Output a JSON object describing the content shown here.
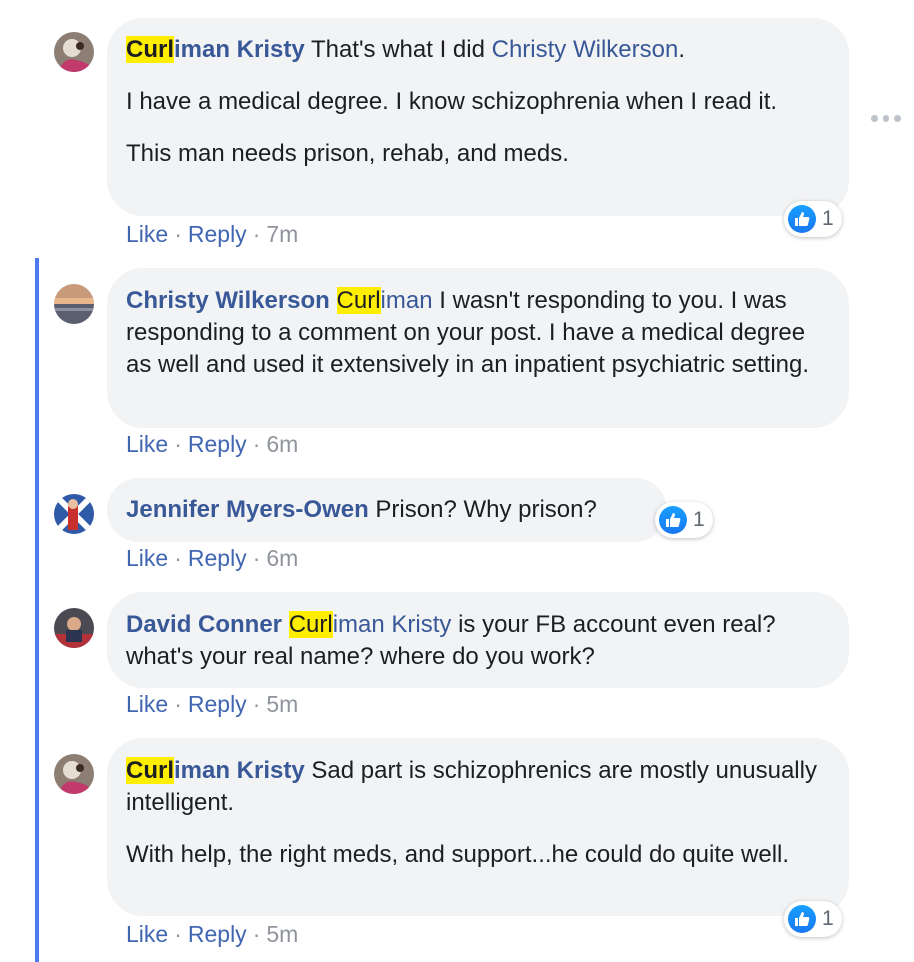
{
  "colors": {
    "link": "#385898",
    "action_link": "#4267b2",
    "highlight": "#ffee00",
    "thread_line": "#4b7bef",
    "bubble": "#f2f3f5",
    "like_blue": "#1877f2"
  },
  "icons": {
    "reaction": "like-thumbs-up-icon",
    "menu": "more-options-icon"
  },
  "comments": [
    {
      "author_highlight": "Curl",
      "author_rest": "iman Kristy",
      "text_before_mention": "That's what I did",
      "mention": "Christy Wilkerson",
      "text_after_mention": ".",
      "paragraphs": [
        "I have a medical degree. I know schizophrenia when I read it.",
        "This man needs prison, rehab, and meds."
      ],
      "actions": {
        "like": "Like",
        "reply": "Reply",
        "time": "7m"
      },
      "reaction_count": "1"
    },
    {
      "author": "Christy Wilkerson",
      "mention_highlight": "Curl",
      "mention_rest": "iman",
      "text": "I wasn't responding to you. I was responding to a comment on your post. I have a medical degree as well and used it extensively in an inpatient psychiatric setting.",
      "actions": {
        "like": "Like",
        "reply": "Reply",
        "time": "6m"
      }
    },
    {
      "author": "Jennifer Myers-Owen",
      "text": "Prison? Why prison?",
      "actions": {
        "like": "Like",
        "reply": "Reply",
        "time": "6m"
      },
      "reaction_count": "1"
    },
    {
      "author": "David Conner",
      "mention_highlight": "Curl",
      "mention_rest": "iman Kristy",
      "text": "is your FB account even real? what's your real name? where do you work?",
      "actions": {
        "like": "Like",
        "reply": "Reply",
        "time": "5m"
      }
    },
    {
      "author_highlight": "Curl",
      "author_rest": "iman Kristy",
      "text": "Sad part is schizophrenics are mostly unusually intelligent.",
      "paragraphs": [
        "With help, the right meds, and support...he could do quite well."
      ],
      "actions": {
        "like": "Like",
        "reply": "Reply",
        "time": "5m"
      },
      "reaction_count": "1"
    }
  ]
}
